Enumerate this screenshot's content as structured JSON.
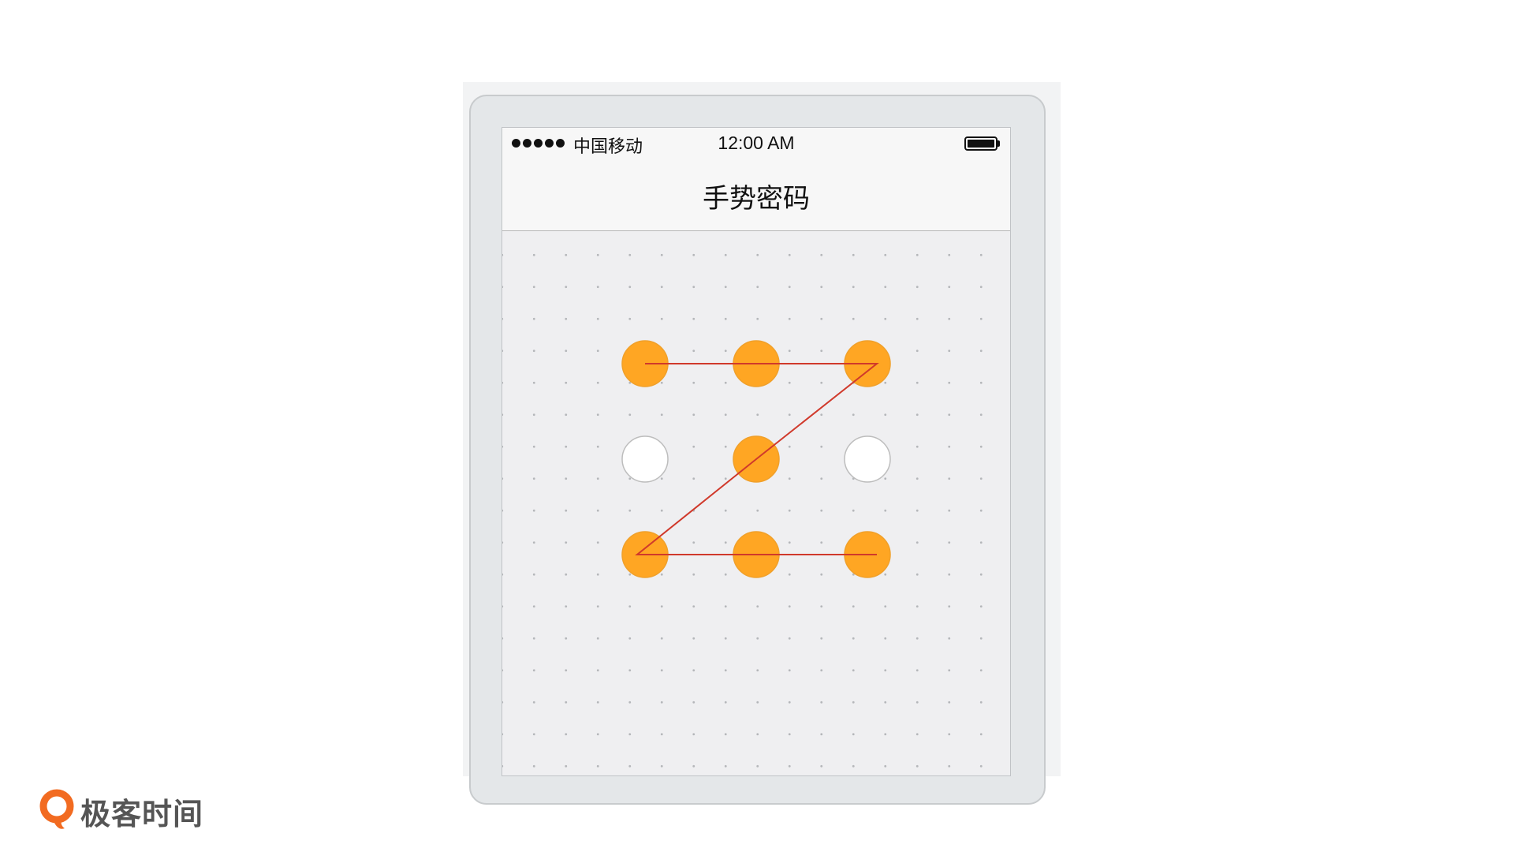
{
  "status_bar": {
    "signal_dots": 5,
    "carrier": "中国移动",
    "time": "12:00 AM",
    "battery_level": 1.0
  },
  "nav": {
    "title": "手势密码"
  },
  "gesture_pad": {
    "rows": 3,
    "cols": 3,
    "selected_color": "#FFA623",
    "unselected_color": "#FFFFFF",
    "line_color": "#D0392B",
    "nodes": [
      {
        "label": "1",
        "selected": true
      },
      {
        "label": "2",
        "selected": true
      },
      {
        "label": "3",
        "selected": true
      },
      {
        "label": "4",
        "selected": false
      },
      {
        "label": "5",
        "selected": true
      },
      {
        "label": "6",
        "selected": false
      },
      {
        "label": "7",
        "selected": true
      },
      {
        "label": "8",
        "selected": true
      },
      {
        "label": "9",
        "selected": true
      }
    ],
    "path": [
      1,
      2,
      3,
      5,
      7,
      8,
      9
    ]
  },
  "brand": {
    "name": "极客时间",
    "accent_color": "#F26B21",
    "icon": "geektime-logo-icon"
  }
}
